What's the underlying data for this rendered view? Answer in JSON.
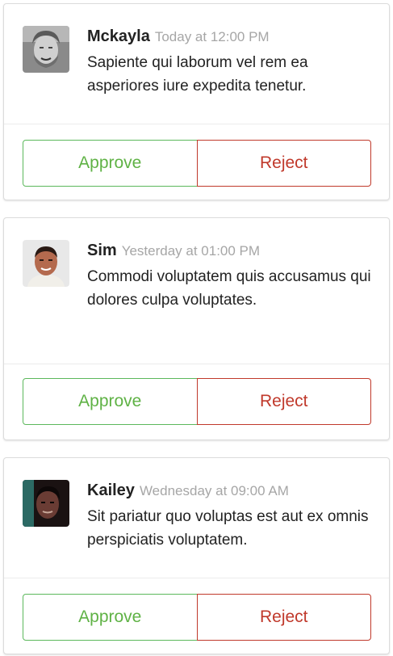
{
  "cards": [
    {
      "author": "Mckayla",
      "date": "Today at 12:00 PM",
      "text": "Sapiente qui laborum vel rem ea asperiores iure expedita tenetur.",
      "approve_label": "Approve",
      "reject_label": "Reject"
    },
    {
      "author": "Sim",
      "date": "Yesterday at 01:00 PM",
      "text": "Commodi voluptatem quis accusamus qui dolores culpa voluptates.",
      "approve_label": "Approve",
      "reject_label": "Reject"
    },
    {
      "author": "Kailey",
      "date": "Wednesday at 09:00 AM",
      "text": "Sit pariatur quo voluptas est aut ex omnis perspiciatis voluptatem.",
      "approve_label": "Approve",
      "reject_label": "Reject"
    }
  ],
  "colors": {
    "approve": "#5cb85c",
    "reject": "#c0392b",
    "date_text": "#a6a6a6"
  }
}
